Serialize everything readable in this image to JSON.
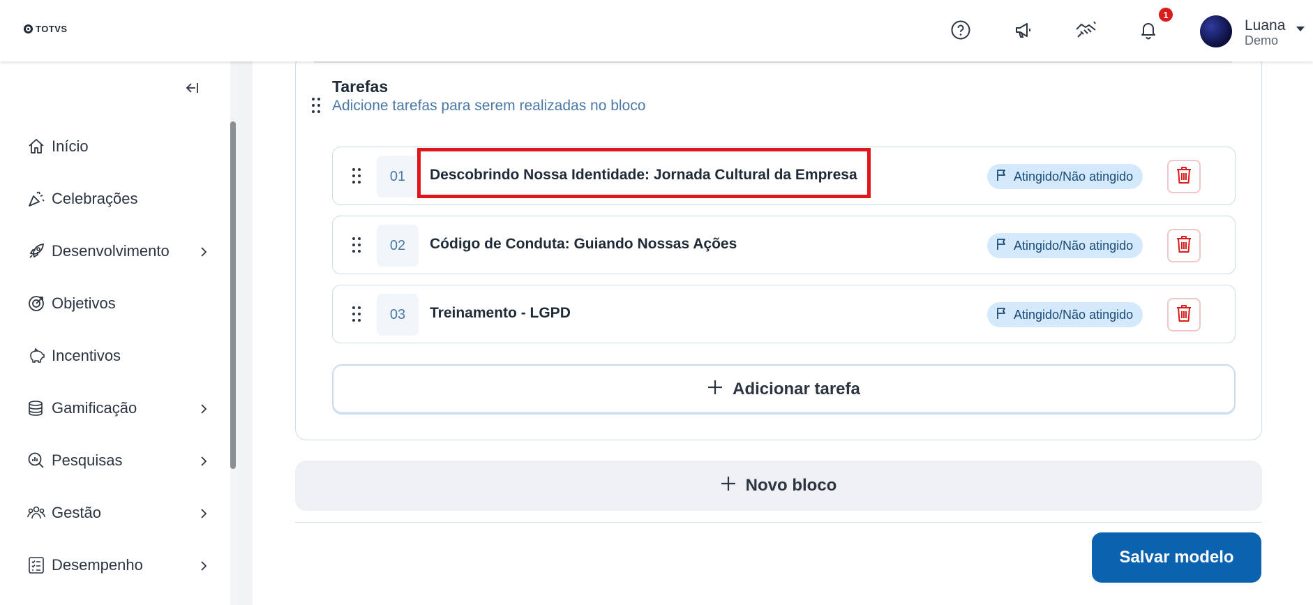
{
  "header": {
    "logo_text": "TOTVS",
    "icons": [
      "help-icon",
      "megaphone-icon",
      "handshake-icon",
      "bell-icon"
    ],
    "notification_count": "1",
    "user_name": "Luana",
    "user_subtitle": "Demo"
  },
  "sidebar": {
    "items": [
      {
        "label": "Início",
        "icon": "home-icon",
        "has_submenu": false
      },
      {
        "label": "Celebrações",
        "icon": "confetti-icon",
        "has_submenu": false
      },
      {
        "label": "Desenvolvimento",
        "icon": "rocket-icon",
        "has_submenu": true
      },
      {
        "label": "Objetivos",
        "icon": "target-icon",
        "has_submenu": false
      },
      {
        "label": "Incentivos",
        "icon": "piggy-bank-icon",
        "has_submenu": false
      },
      {
        "label": "Gamificação",
        "icon": "coins-icon",
        "has_submenu": true
      },
      {
        "label": "Pesquisas",
        "icon": "search-chart-icon",
        "has_submenu": true
      },
      {
        "label": "Gestão",
        "icon": "team-icon",
        "has_submenu": true
      },
      {
        "label": "Desempenho",
        "icon": "checklist-icon",
        "has_submenu": true
      }
    ]
  },
  "block": {
    "title": "Tarefas",
    "subtitle": "Adicione tarefas para serem realizadas no bloco",
    "tasks": [
      {
        "number": "01",
        "title": "Descobrindo Nossa Identidade: Jornada Cultural da Empresa",
        "tag": "Atingido/Não atingido"
      },
      {
        "number": "02",
        "title": "Código de Conduta: Guiando Nossas Ações",
        "tag": "Atingido/Não atingido"
      },
      {
        "number": "03",
        "title": "Treinamento - LGPD",
        "tag": "Atingido/Não atingido"
      }
    ],
    "add_task_label": "Adicionar tarefa"
  },
  "new_block_label": "Novo bloco",
  "save_label": "Salvar modelo",
  "colors": {
    "primary": "#0b63b0",
    "tag_bg": "#d4e9fb",
    "danger": "#d91c1c",
    "highlight": "#e0161d"
  }
}
